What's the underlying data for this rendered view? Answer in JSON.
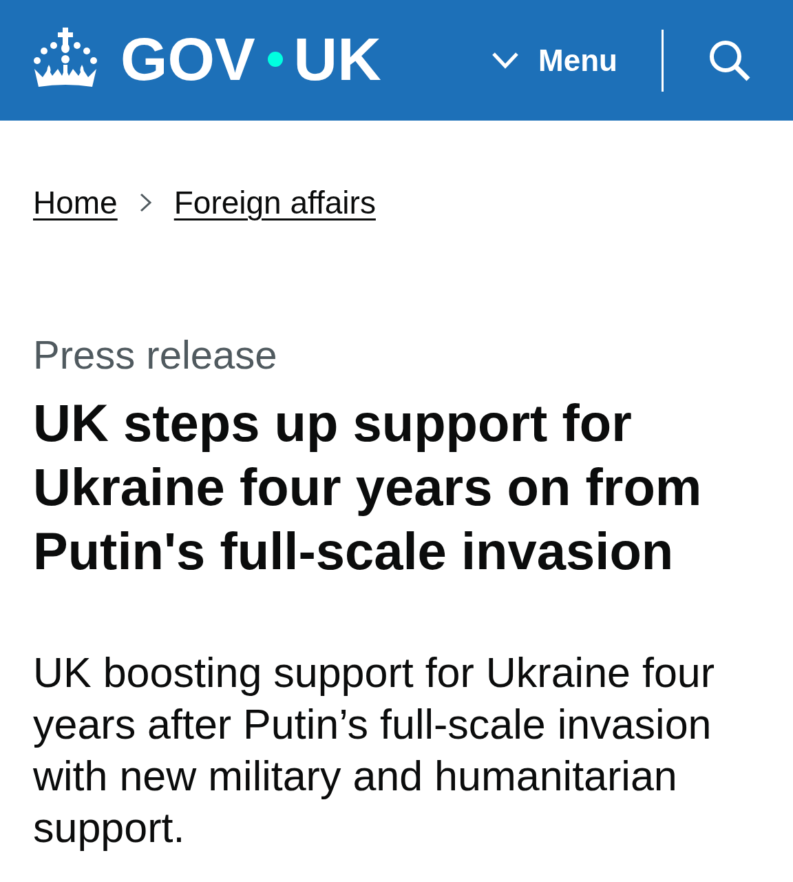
{
  "header": {
    "logo": {
      "text_left": "GOV",
      "text_right": "UK"
    },
    "menu_button": {
      "label": "Menu",
      "expanded": false
    }
  },
  "breadcrumbs": [
    {
      "label": "Home"
    },
    {
      "label": "Foreign affairs"
    }
  ],
  "document_type": "Press release",
  "title": "UK steps up support for Ukraine four years on from Putin's full-scale invasion",
  "lead": "UK boosting support for Ukraine four years after Putin’s full-scale invasion with new military and humanitarian support."
}
